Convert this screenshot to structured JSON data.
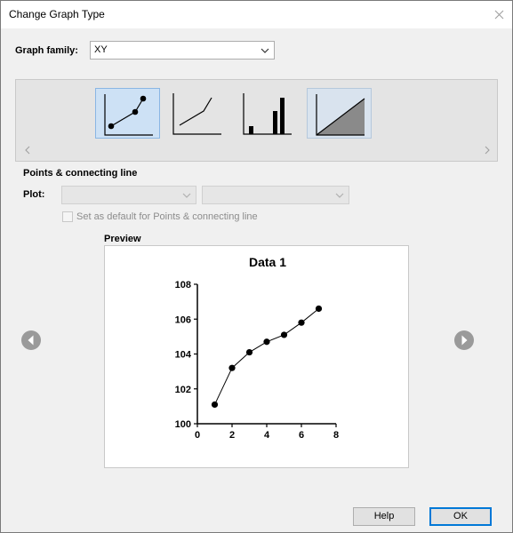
{
  "window": {
    "title": "Change Graph Type"
  },
  "graph_family": {
    "label": "Graph family:",
    "value": "XY"
  },
  "gallery": {
    "icons": [
      "points-connecting-line-graph-icon",
      "line-graph-icon",
      "bar-spike-graph-icon",
      "area-fill-graph-icon"
    ]
  },
  "section": {
    "title": "Points & connecting line"
  },
  "plot": {
    "label": "Plot:",
    "value1": "",
    "value2": ""
  },
  "default_checkbox": {
    "label": "Set as default for Points & connecting line",
    "checked": false
  },
  "preview": {
    "label": "Preview"
  },
  "chart_data": {
    "type": "line",
    "title": "Data 1",
    "xlabel": "",
    "ylabel": "",
    "x": [
      1,
      2,
      3,
      4,
      5,
      6,
      7
    ],
    "series": [
      {
        "values": [
          101.1,
          103.2,
          104.1,
          104.7,
          105.1,
          105.8,
          106.6
        ]
      }
    ],
    "xlim": [
      0,
      8
    ],
    "ylim": [
      100,
      108
    ],
    "xticks": [
      "0",
      "2",
      "4",
      "6",
      "8"
    ],
    "yticks": [
      "100",
      "102",
      "104",
      "106",
      "108"
    ],
    "markers": "filled-circle",
    "grid": false
  },
  "buttons": {
    "help": "Help",
    "ok": "OK"
  }
}
